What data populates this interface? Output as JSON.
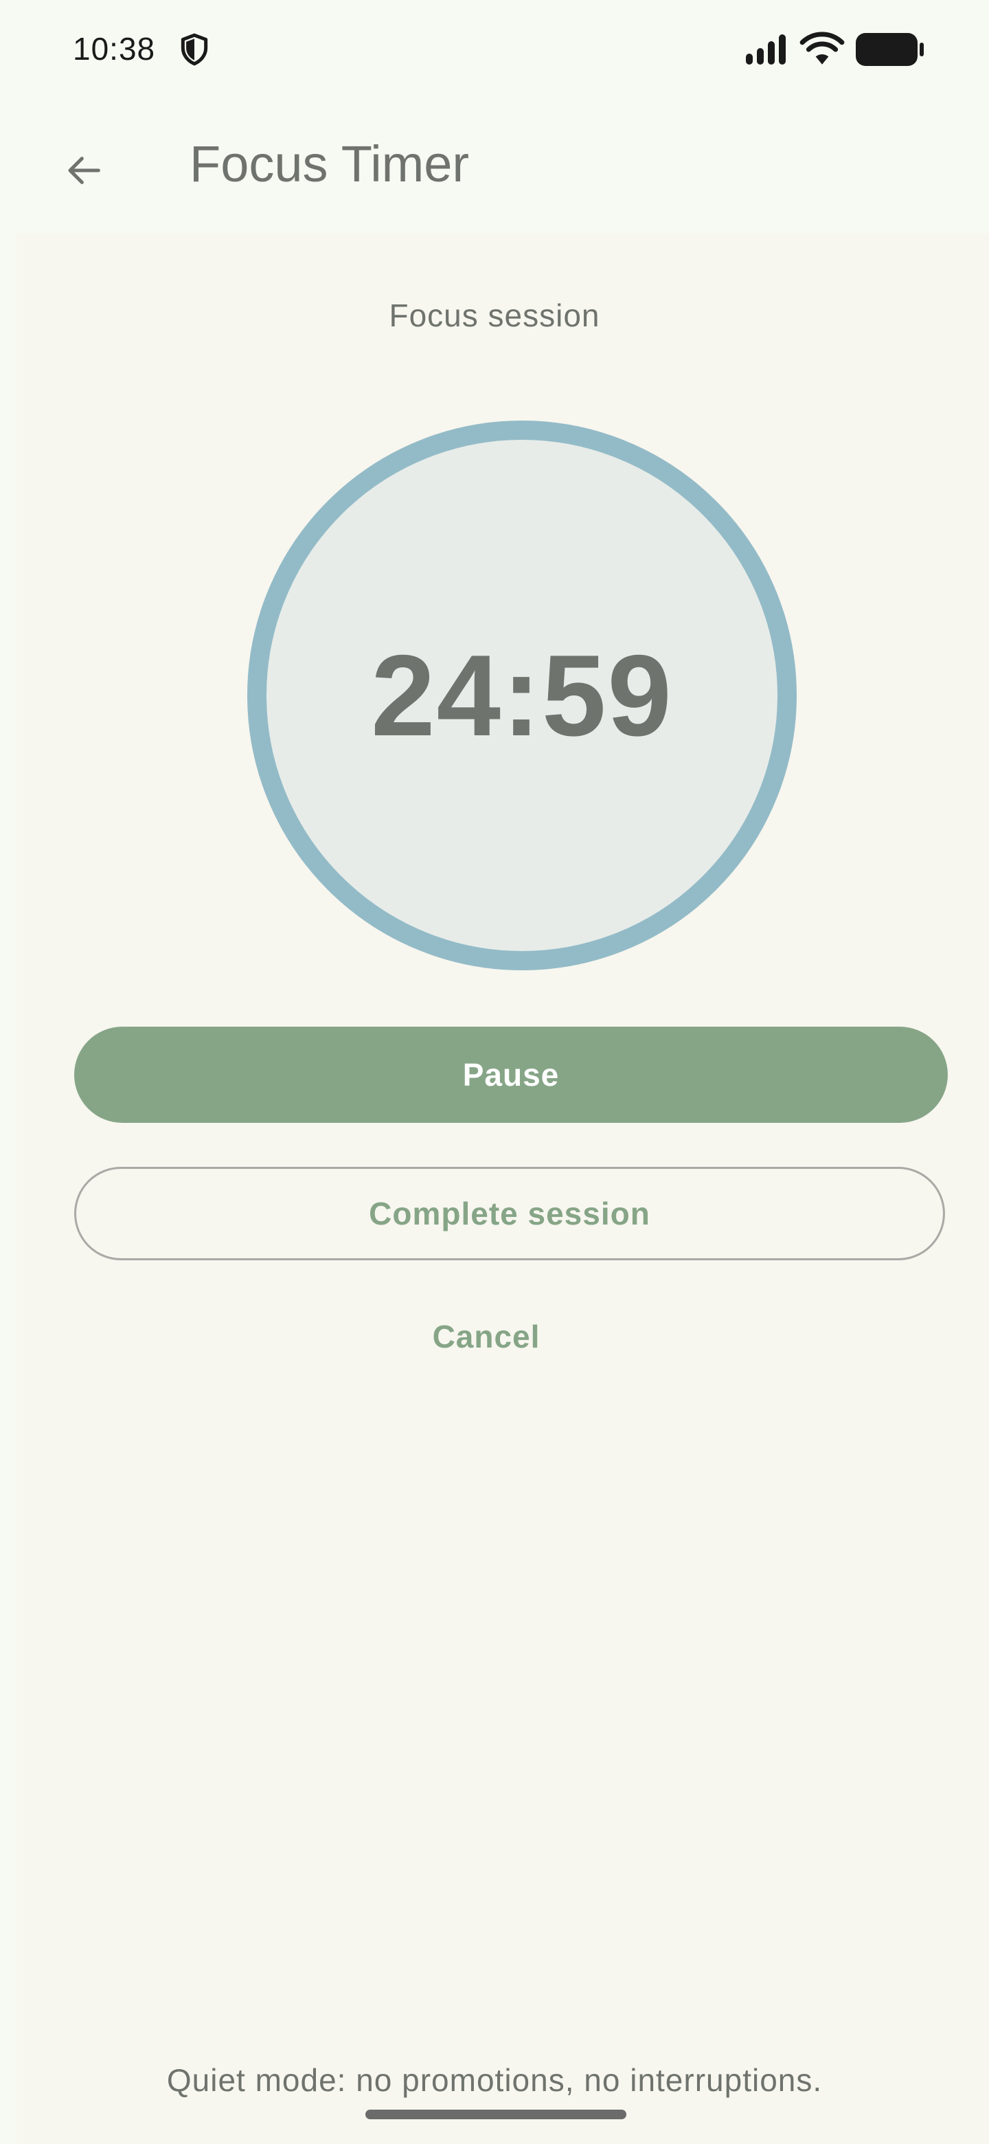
{
  "status_bar": {
    "time": "10:38",
    "icons": [
      "shield-icon",
      "cellular-signal-icon",
      "wifi-icon",
      "battery-icon"
    ]
  },
  "app_bar": {
    "title": "Focus Timer",
    "back_icon": "arrow-back-icon"
  },
  "session": {
    "label": "Focus session",
    "timer": "24:59"
  },
  "actions": {
    "pause_label": "Pause",
    "complete_label": "Complete session",
    "cancel_label": "Cancel"
  },
  "footer": {
    "note": "Quiet mode: no promotions, no interruptions."
  },
  "colors": {
    "accent_green": "#86a587",
    "ring_blue": "#93bbc7",
    "circle_fill": "#e7ece9",
    "text_gray": "#6f736d",
    "background": "#f7f6ef"
  }
}
